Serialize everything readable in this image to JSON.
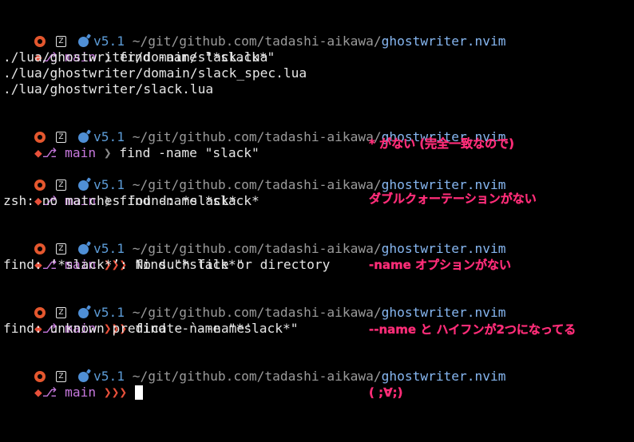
{
  "prompt": {
    "version": "v5.1",
    "path_prefix": "~/git/github.com/tadashi-aikawa/",
    "path_repo": "ghostwriter.nvim",
    "git_marker": "◆",
    "branch_icon": "⎇",
    "branch": "main",
    "chevron_ok": "❯",
    "chevron_err": "❯❯❯",
    "zsh_icon": "Z",
    "os_icon": "ubuntu-icon",
    "node_icon": "bomb-icon"
  },
  "blocks": [
    {
      "status": "ok",
      "command": "find -name \"*slack*\"",
      "output": [
        "./lua/ghostwriter/domain/slack.lua",
        "./lua/ghostwriter/domain/slack_spec.lua",
        "./lua/ghostwriter/slack.lua"
      ]
    },
    {
      "status": "ok",
      "command": "find -name \"slack\"",
      "output": []
    },
    {
      "status": "ok",
      "command": "find -name *slack*",
      "output": [
        "zsh: no matches found: *slack*"
      ]
    },
    {
      "status": "err",
      "command": "find \"*slack*\"",
      "output": [
        "find: ‘*slack*’: No such file or directory"
      ]
    },
    {
      "status": "err",
      "command": "find --name \"*slack*\"",
      "output": [
        "find: unknown predicate `--name'"
      ]
    },
    {
      "status": "err",
      "command": "",
      "output": [],
      "cursor": true
    }
  ],
  "annotations": [
    "* がない (完全一致なので)",
    "ダブルクォーテーションがない",
    "-name オプションがない",
    "--name と ハイフンが2つになってる",
    "( ;∀;)"
  ],
  "colors": {
    "background": "#000000",
    "text": "#e6e6e6",
    "version": "#5c9bd6",
    "repo": "#86b6f0",
    "path": "#9a9a9a",
    "error_chevron": "#e8503a",
    "branch": "#c678dd",
    "annotation": "#ff2d78"
  }
}
